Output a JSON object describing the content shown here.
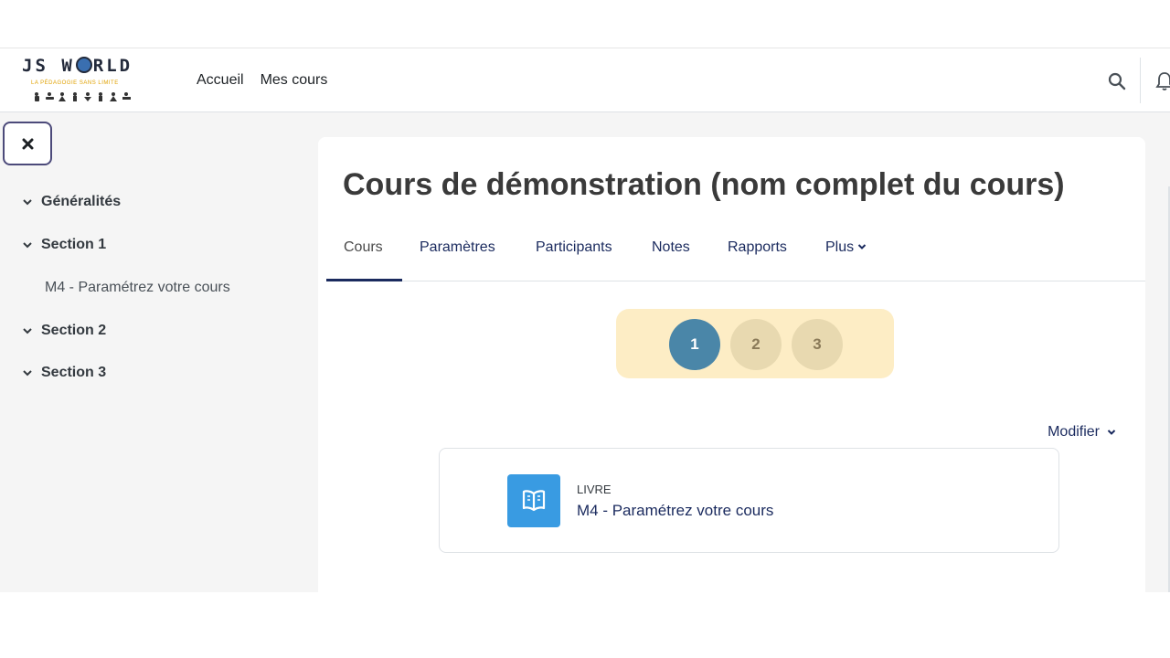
{
  "logo": {
    "title_left": "JS W",
    "title_right": "RLD",
    "tagline": "LA PÉDAGOGIE SANS LIMITE"
  },
  "nav": {
    "links": [
      {
        "label": "Accueil"
      },
      {
        "label": "Mes cours"
      }
    ]
  },
  "drawer": {
    "items": [
      {
        "label": "Généralités",
        "type": "section"
      },
      {
        "label": "Section 1",
        "type": "section"
      },
      {
        "label": "M4 - Paramétrez votre cours",
        "type": "activity"
      },
      {
        "label": "Section 2",
        "type": "section"
      },
      {
        "label": "Section 3",
        "type": "section"
      }
    ]
  },
  "course": {
    "title": "Cours de démonstration (nom complet du cours)",
    "tabs": [
      {
        "label": "Cours",
        "active": true
      },
      {
        "label": "Paramètres"
      },
      {
        "label": "Participants"
      },
      {
        "label": "Notes"
      },
      {
        "label": "Rapports"
      },
      {
        "label": "Plus"
      }
    ],
    "pages": [
      "1",
      "2",
      "3"
    ],
    "current_page": "1",
    "edit_label": "Modifier",
    "activity": {
      "type_label": "LIVRE",
      "name": "M4 - Paramétrez votre cours",
      "icon": "book-icon"
    }
  },
  "colors": {
    "accent": "#1a2a5e",
    "pager_bg": "#fdedc5",
    "page_active": "#4a86a8",
    "activity_icon_bg": "#399be2"
  }
}
